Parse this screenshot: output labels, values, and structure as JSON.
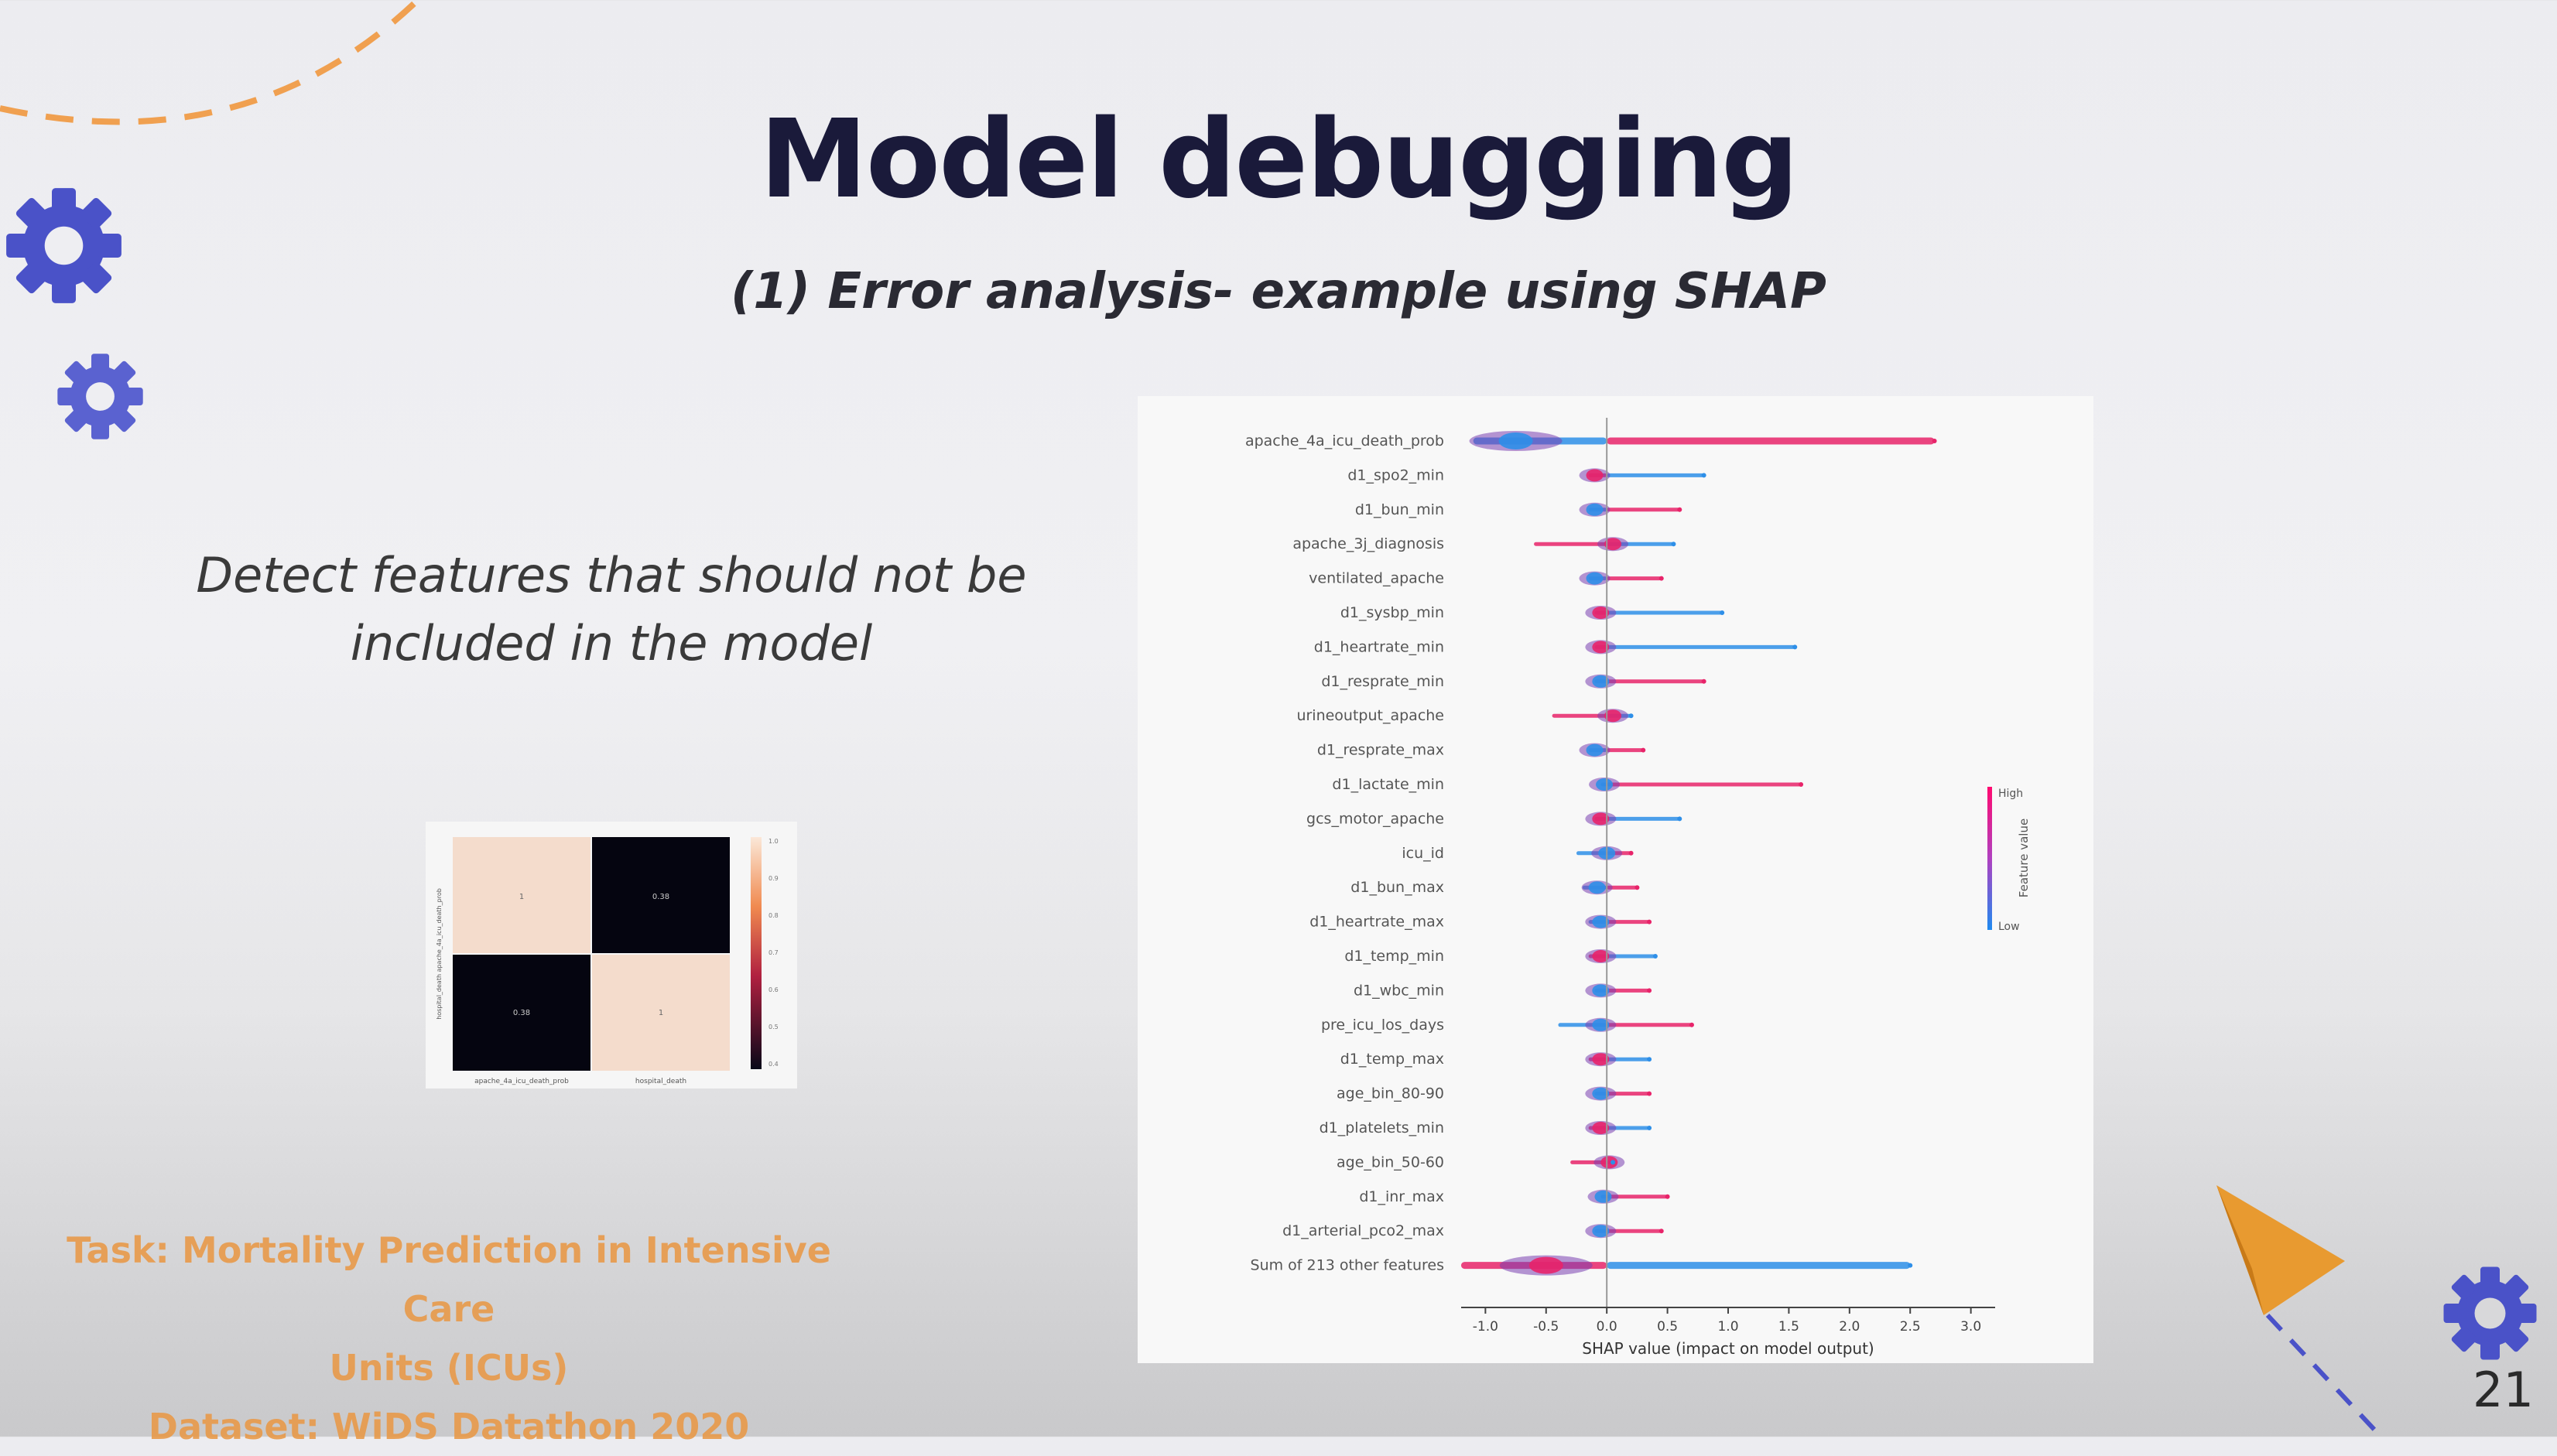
{
  "slide": {
    "title": "Model debugging",
    "subtitle": "(1)  Error analysis- example using SHAP",
    "detect_line1": "Detect features that should not be",
    "detect_line2": "included in the model",
    "footer_line1": "Task: Mortality Prediction in Intensive Care",
    "footer_line2": "Units (ICUs)",
    "footer_line3": "Dataset: WiDS Datathon 2020",
    "page_number": "21"
  },
  "colors": {
    "title": "#1a1a3a",
    "footer": "#e89a4a",
    "gear": "#4a52c8",
    "arc": "#f0a050",
    "arrow": "#e89a30",
    "shap_high": "#e8246a",
    "shap_low": "#2e8fe8"
  },
  "icons": [
    "gear-icon",
    "paper-plane-icon"
  ],
  "heatmap": {
    "cells": [
      [
        "1",
        "0.38"
      ],
      [
        "0.38",
        "1"
      ]
    ],
    "x_labels": [
      "apache_4a_icu_death_prob",
      "hospital_death"
    ],
    "y_label": "hospital_death  apache_4a_icu_death_prob",
    "colorbar_ticks": [
      "1.0",
      "0.9",
      "0.8",
      "0.7",
      "0.6",
      "0.5",
      "0.4"
    ]
  },
  "chart_data": {
    "type": "scatter",
    "subtype": "shap-beeswarm",
    "title": "",
    "xlabel": "SHAP value (impact on model output)",
    "ylabel": "",
    "xlim": [
      -1.2,
      3.2
    ],
    "x_ticks": [
      "-1.0",
      "-0.5",
      "0.0",
      "0.5",
      "1.0",
      "1.5",
      "2.0",
      "2.5",
      "3.0"
    ],
    "colorbar": {
      "label": "Feature value",
      "high": "High",
      "low": "Low"
    },
    "features": [
      {
        "name": "apache_4a_icu_death_prob",
        "min": -1.1,
        "max": 2.7,
        "blob": -0.75,
        "high_side": "right"
      },
      {
        "name": "d1_spo2_min",
        "min": -0.15,
        "max": 0.8,
        "blob": -0.1,
        "high_side": "left"
      },
      {
        "name": "d1_bun_min",
        "min": -0.15,
        "max": 0.6,
        "blob": -0.1,
        "high_side": "right"
      },
      {
        "name": "apache_3j_diagnosis",
        "min": -0.6,
        "max": 0.55,
        "blob": 0.05,
        "high_side": "left"
      },
      {
        "name": "ventilated_apache",
        "min": -0.15,
        "max": 0.45,
        "blob": -0.1,
        "high_side": "right"
      },
      {
        "name": "d1_sysbp_min",
        "min": -0.1,
        "max": 0.95,
        "blob": -0.05,
        "high_side": "left"
      },
      {
        "name": "d1_heartrate_min",
        "min": -0.1,
        "max": 1.55,
        "blob": -0.05,
        "high_side": "left"
      },
      {
        "name": "d1_resprate_min",
        "min": -0.1,
        "max": 0.8,
        "blob": -0.05,
        "high_side": "right"
      },
      {
        "name": "urineoutput_apache",
        "min": -0.45,
        "max": 0.2,
        "blob": 0.05,
        "high_side": "left"
      },
      {
        "name": "d1_resprate_max",
        "min": -0.15,
        "max": 0.3,
        "blob": -0.1,
        "high_side": "right"
      },
      {
        "name": "d1_lactate_min",
        "min": -0.05,
        "max": 1.6,
        "blob": -0.02,
        "high_side": "right"
      },
      {
        "name": "gcs_motor_apache",
        "min": -0.1,
        "max": 0.6,
        "blob": -0.05,
        "high_side": "left"
      },
      {
        "name": "icu_id",
        "min": -0.25,
        "max": 0.2,
        "blob": 0.0,
        "high_side": "right"
      },
      {
        "name": "d1_bun_max",
        "min": -0.2,
        "max": 0.25,
        "blob": -0.08,
        "high_side": "right"
      },
      {
        "name": "d1_heartrate_max",
        "min": -0.15,
        "max": 0.35,
        "blob": -0.05,
        "high_side": "right"
      },
      {
        "name": "d1_temp_min",
        "min": -0.15,
        "max": 0.4,
        "blob": -0.05,
        "high_side": "left"
      },
      {
        "name": "d1_wbc_min",
        "min": -0.1,
        "max": 0.35,
        "blob": -0.05,
        "high_side": "right"
      },
      {
        "name": "pre_icu_los_days",
        "min": -0.4,
        "max": 0.7,
        "blob": -0.05,
        "high_side": "right"
      },
      {
        "name": "d1_temp_max",
        "min": -0.15,
        "max": 0.35,
        "blob": -0.05,
        "high_side": "left"
      },
      {
        "name": "age_bin_80-90",
        "min": -0.1,
        "max": 0.35,
        "blob": -0.05,
        "high_side": "right"
      },
      {
        "name": "d1_platelets_min",
        "min": -0.15,
        "max": 0.35,
        "blob": -0.05,
        "high_side": "left"
      },
      {
        "name": "age_bin_50-60",
        "min": -0.3,
        "max": 0.05,
        "blob": 0.02,
        "high_side": "left"
      },
      {
        "name": "d1_inr_max",
        "min": -0.05,
        "max": 0.5,
        "blob": -0.03,
        "high_side": "right"
      },
      {
        "name": "d1_arterial_pco2_max",
        "min": -0.1,
        "max": 0.45,
        "blob": -0.05,
        "high_side": "right"
      },
      {
        "name": "Sum of 213 other features",
        "min": -1.2,
        "max": 2.5,
        "blob": -0.5,
        "high_side": "left"
      }
    ]
  }
}
